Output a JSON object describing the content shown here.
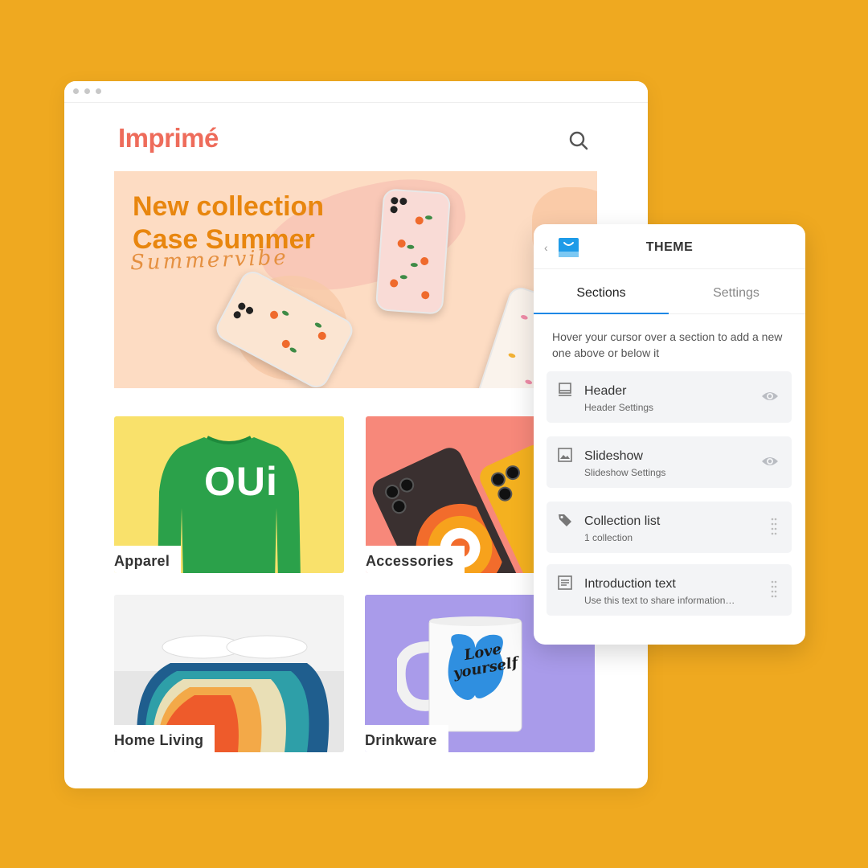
{
  "store": {
    "logo": "Imprimé",
    "hero": {
      "title_line1": "New collection",
      "title_line2": "Case Summer",
      "script": "Summervibe"
    },
    "collections": [
      {
        "label": "Apparel"
      },
      {
        "label": "Accessories"
      },
      {
        "label": "Home Living"
      },
      {
        "label": "Drinkware"
      }
    ],
    "apparel_text": "OUi",
    "mug_text_line1": "Love",
    "mug_text_line2": "yourself"
  },
  "panel": {
    "title": "THEME",
    "tabs": [
      {
        "label": "Sections",
        "active": true
      },
      {
        "label": "Settings",
        "active": false
      }
    ],
    "hint": "Hover your cursor over a section to add a new one above or below it",
    "sections": [
      {
        "title": "Header",
        "subtitle": "Header Settings",
        "icon": "header-layout-icon",
        "action": "eye-icon"
      },
      {
        "title": "Slideshow",
        "subtitle": "Slideshow Settings",
        "icon": "image-icon",
        "action": "eye-icon"
      },
      {
        "title": "Collection list",
        "subtitle": "1 collection",
        "icon": "tag-icon",
        "action": "drag-handle-icon"
      },
      {
        "title": "Introduction text",
        "subtitle": "Use this text to share information…",
        "icon": "text-block-icon",
        "action": "drag-handle-icon"
      }
    ]
  },
  "colors": {
    "background": "#EFA920",
    "logo": "#EE6C5B",
    "hero_title": "#E8860E",
    "tab_accent": "#1E88E5"
  }
}
